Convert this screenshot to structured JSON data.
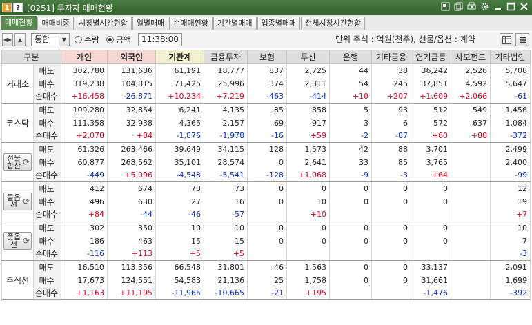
{
  "window": {
    "badge_1": "1",
    "badge_2": "?",
    "title": "[0251] 투자자 매매현황"
  },
  "tabs": [
    {
      "label": "매매현황",
      "active": true
    },
    {
      "label": "매매비중",
      "active": false
    },
    {
      "label": "시장별시간현황",
      "active": false
    },
    {
      "label": "일별매매",
      "active": false
    },
    {
      "label": "순매매현황",
      "active": false
    },
    {
      "label": "기간별매매",
      "active": false
    },
    {
      "label": "업종별매매",
      "active": false
    },
    {
      "label": "전체시장시간현황",
      "active": false
    }
  ],
  "toolbar": {
    "market_select": "통합",
    "radio_qty": "수량",
    "radio_amount": "금액",
    "selected": "금액",
    "time": "11:38:00",
    "unit_text": "단위 주식 : 억원(천주), 선물/옵션 : 계약"
  },
  "columns": [
    "구분",
    "",
    "개인",
    "외국인",
    "기관계",
    "금융투자",
    "보험",
    "투신",
    "은행",
    "기타금융",
    "연기금등",
    "사모펀드",
    "기타법인"
  ],
  "groups": [
    {
      "market": "거래소",
      "has_button": false,
      "rows": [
        {
          "label": "매도",
          "cells": [
            "302,780",
            "131,686",
            "61,191",
            "18,777",
            "837",
            "2,725",
            "44",
            "38",
            "36,242",
            "2,526",
            "5,708"
          ]
        },
        {
          "label": "매수",
          "cells": [
            "319,238",
            "104,815",
            "71,425",
            "25,996",
            "374",
            "2,311",
            "54",
            "245",
            "37,851",
            "4,592",
            "5,647"
          ]
        },
        {
          "label": "순매수",
          "cells": [
            "+16,458",
            "-26,871",
            "+10,234",
            "+7,219",
            "-463",
            "-414",
            "+10",
            "+207",
            "+1,609",
            "+2,066",
            "-61"
          ]
        }
      ]
    },
    {
      "market": "코스닥",
      "has_button": false,
      "rows": [
        {
          "label": "매도",
          "cells": [
            "109,280",
            "32,854",
            "6,241",
            "4,135",
            "85",
            "858",
            "5",
            "93",
            "512",
            "549",
            "1,456"
          ]
        },
        {
          "label": "매수",
          "cells": [
            "111,358",
            "32,938",
            "4,365",
            "2,157",
            "69",
            "917",
            "3",
            "6",
            "572",
            "637",
            "1,084"
          ]
        },
        {
          "label": "순매수",
          "cells": [
            "+2,078",
            "+84",
            "-1,876",
            "-1,978",
            "-16",
            "+59",
            "-2",
            "-87",
            "+60",
            "+88",
            "-372"
          ]
        }
      ]
    },
    {
      "market": "선물합산",
      "has_button": true,
      "rows": [
        {
          "label": "매도",
          "cells": [
            "61,326",
            "263,466",
            "39,649",
            "34,115",
            "128",
            "1,573",
            "42",
            "88",
            "3,701",
            "",
            "2,499"
          ]
        },
        {
          "label": "매수",
          "cells": [
            "60,877",
            "268,562",
            "35,101",
            "28,574",
            "0",
            "2,641",
            "33",
            "85",
            "3,765",
            "",
            "2,400"
          ]
        },
        {
          "label": "순매수",
          "cells": [
            "-449",
            "+5,096",
            "-4,548",
            "-5,541",
            "-128",
            "+1,068",
            "-9",
            "-3",
            "+64",
            "",
            "-99"
          ]
        }
      ]
    },
    {
      "market": "콜옵션",
      "has_button": true,
      "rows": [
        {
          "label": "매도",
          "cells": [
            "412",
            "674",
            "73",
            "73",
            "0",
            "0",
            "0",
            "0",
            "0",
            "",
            "12"
          ]
        },
        {
          "label": "매수",
          "cells": [
            "496",
            "630",
            "27",
            "16",
            "0",
            "10",
            "0",
            "0",
            "0",
            "",
            "19"
          ]
        },
        {
          "label": "순매수",
          "cells": [
            "+84",
            "-44",
            "-46",
            "-57",
            "",
            "+10",
            "",
            "",
            "",
            "",
            "+7"
          ]
        }
      ]
    },
    {
      "market": "풋옵션",
      "has_button": true,
      "rows": [
        {
          "label": "매도",
          "cells": [
            "302",
            "350",
            "10",
            "10",
            "0",
            "0",
            "0",
            "0",
            "0",
            "",
            "10"
          ]
        },
        {
          "label": "매수",
          "cells": [
            "186",
            "463",
            "15",
            "15",
            "0",
            "0",
            "0",
            "0",
            "0",
            "",
            "7"
          ]
        },
        {
          "label": "순매수",
          "cells": [
            "-116",
            "+113",
            "+5",
            "+5",
            "",
            "",
            "",
            "",
            "",
            "",
            "-3"
          ]
        }
      ]
    },
    {
      "market": "주식선",
      "has_button": false,
      "rows": [
        {
          "label": "매도",
          "cells": [
            "16,510",
            "113,356",
            "66,548",
            "31,801",
            "46",
            "1,563",
            "0",
            "0",
            "33,137",
            "",
            "2,091"
          ]
        },
        {
          "label": "매수",
          "cells": [
            "17,673",
            "124,551",
            "54,583",
            "21,136",
            "25",
            "1,758",
            "0",
            "0",
            "31,661",
            "",
            "1,699"
          ]
        },
        {
          "label": "순매수",
          "cells": [
            "+1,163",
            "+11,195",
            "-11,965",
            "-10,665",
            "-21",
            "+195",
            "",
            "",
            "-1,476",
            "",
            "-392"
          ]
        }
      ]
    }
  ],
  "colors": {
    "positive": "#e0001e",
    "negative": "#0a2fc7",
    "titlebar": "#3d6b37",
    "active_tab": "#5b8a52",
    "header_individual": "#f6d7d4",
    "header_institution": "#f3f0cf"
  },
  "icons": {
    "window_icons": [
      "restore-icon",
      "copy-icon",
      "print-icon",
      "settings-icon",
      "minimize-icon",
      "maximize-icon",
      "close-icon"
    ],
    "toolbar_icons": [
      "table-view-icon",
      "menu-icon"
    ],
    "market_button_icon": "refresh-icon"
  }
}
